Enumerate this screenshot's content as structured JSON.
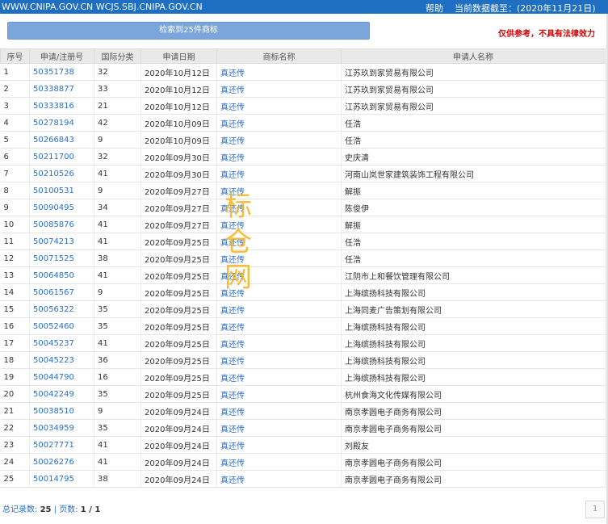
{
  "header": {
    "url": "WWW.CNIPA.GOV.CN WCJS.SBJ.CNIPA.GOV.CN",
    "help": "帮助",
    "date_label": "当前数据截至：",
    "date_value": "(2020年11月21日)"
  },
  "search": {
    "result_label": "检索到25件商标",
    "disclaimer": "仅供参考，不具有法律效力"
  },
  "table": {
    "columns": [
      "序号",
      "申请/注册号",
      "国际分类",
      "申请日期",
      "商标名称",
      "申请人名称"
    ],
    "rows": [
      [
        "1",
        "50351738",
        "32",
        "2020年10月12日",
        "真还传",
        "江苏玖到家贸易有限公司"
      ],
      [
        "2",
        "50338877",
        "33",
        "2020年10月12日",
        "真还传",
        "江苏玖到家贸易有限公司"
      ],
      [
        "3",
        "50333816",
        "21",
        "2020年10月12日",
        "真还传",
        "江苏玖到家贸易有限公司"
      ],
      [
        "4",
        "50278194",
        "42",
        "2020年10月09日",
        "真还传",
        "任浩"
      ],
      [
        "5",
        "50266843",
        "9",
        "2020年10月09日",
        "真还传",
        "任浩"
      ],
      [
        "6",
        "50211700",
        "32",
        "2020年09月30日",
        "真还传",
        "史庆清"
      ],
      [
        "7",
        "50210526",
        "41",
        "2020年09月30日",
        "真还传",
        "河南山岚世家建筑装饰工程有限公司"
      ],
      [
        "8",
        "50100531",
        "9",
        "2020年09月27日",
        "真还传",
        "解振"
      ],
      [
        "9",
        "50090495",
        "34",
        "2020年09月27日",
        "真还传",
        "陈俊伊"
      ],
      [
        "10",
        "50085876",
        "41",
        "2020年09月27日",
        "真还传",
        "解振"
      ],
      [
        "11",
        "50074213",
        "41",
        "2020年09月25日",
        "真还传",
        "任浩"
      ],
      [
        "12",
        "50071525",
        "38",
        "2020年09月25日",
        "真还传",
        "任浩"
      ],
      [
        "13",
        "50064850",
        "41",
        "2020年09月25日",
        "真还传",
        "江阴市上和餐饮管理有限公司"
      ],
      [
        "14",
        "50061567",
        "9",
        "2020年09月25日",
        "真还传",
        "上海缤扬科技有限公司"
      ],
      [
        "15",
        "50056322",
        "35",
        "2020年09月25日",
        "真还传",
        "上海同麦广告策划有限公司"
      ],
      [
        "16",
        "50052460",
        "35",
        "2020年09月25日",
        "真还传",
        "上海缤扬科技有限公司"
      ],
      [
        "17",
        "50045237",
        "41",
        "2020年09月25日",
        "真还传",
        "上海缤扬科技有限公司"
      ],
      [
        "18",
        "50045223",
        "36",
        "2020年09月25日",
        "真还传",
        "上海缤扬科技有限公司"
      ],
      [
        "19",
        "50044790",
        "16",
        "2020年09月25日",
        "真还传",
        "上海缤扬科技有限公司"
      ],
      [
        "20",
        "50042249",
        "35",
        "2020年09月25日",
        "真还传",
        "杭州食海文化传媒有限公司"
      ],
      [
        "21",
        "50038510",
        "9",
        "2020年09月24日",
        "真还传",
        "南京孝圆电子商务有限公司"
      ],
      [
        "22",
        "50034959",
        "35",
        "2020年09月24日",
        "真还传",
        "南京孝圆电子商务有限公司"
      ],
      [
        "23",
        "50027771",
        "41",
        "2020年09月24日",
        "真还传",
        "刘殿友"
      ],
      [
        "24",
        "50026276",
        "41",
        "2020年09月24日",
        "真还传",
        "南京孝圆电子商务有限公司"
      ],
      [
        "25",
        "50014795",
        "38",
        "2020年09月24日",
        "真还传",
        "南京孝圆电子商务有限公司"
      ]
    ]
  },
  "watermark": {
    "chars": [
      "标",
      "仓",
      "网"
    ],
    "color": "#f4b41a"
  },
  "footer": {
    "total_label": "总记录数:",
    "total_value": "25",
    "separator": "|",
    "pages_label": "页数:",
    "pages_value": "1 / 1",
    "page_button": "1"
  },
  "colors": {
    "header_bg": "#1e6fc2",
    "link": "#2a70c7",
    "disclaimer": "#d40000",
    "button_bg": "#7ba6dc"
  }
}
